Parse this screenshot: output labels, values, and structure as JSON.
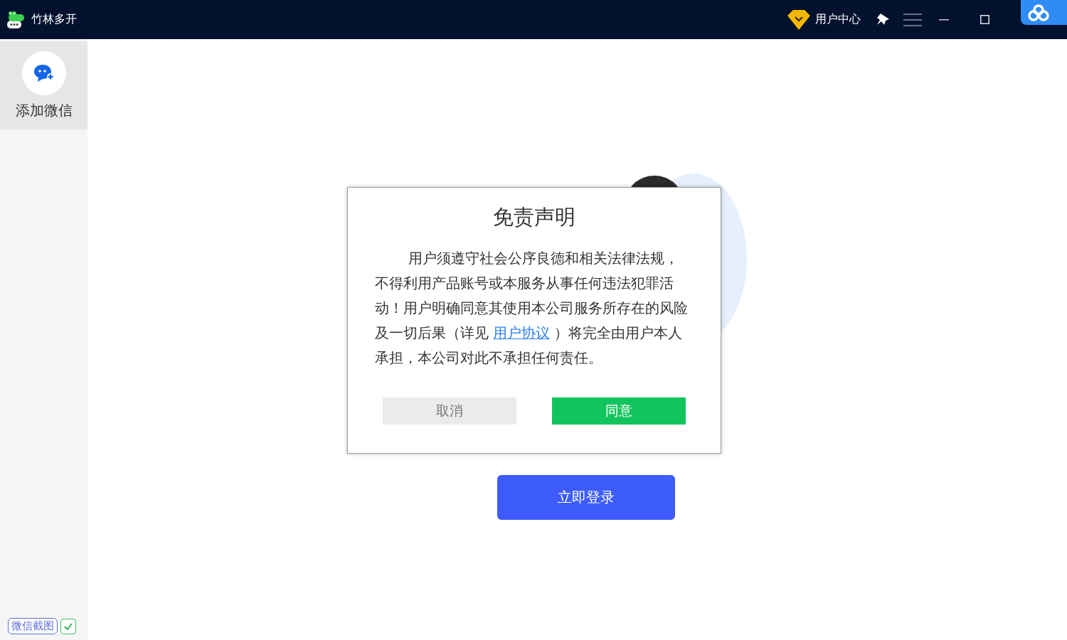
{
  "app": {
    "title": "竹林多开"
  },
  "header": {
    "user_center": "用户中心"
  },
  "sidebar": {
    "items": [
      {
        "label": "添加微信",
        "selected": true
      }
    ]
  },
  "footer": {
    "screenshot": {
      "label": "微信截图",
      "checked": true
    }
  },
  "main": {
    "login_button": "立即登录"
  },
  "dialog": {
    "title": "免责声明",
    "body_before": "用户须遵守社会公序良德和相关法律法规，不得利用产品账号或本服务从事任何违法犯罪活动！用户明确同意其使用本公司服务所存在的风险及一切后果（详见 ",
    "link": "用户协议",
    "body_after": " ）将完全由用户本人承担，本公司对此不承担任何责任。",
    "buttons": [
      {
        "label": "取消",
        "kind": "cancel"
      },
      {
        "label": "同意",
        "kind": "confirm"
      }
    ]
  }
}
